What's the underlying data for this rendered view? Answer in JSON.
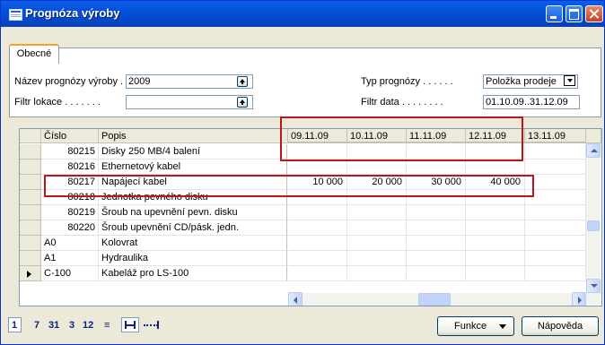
{
  "window": {
    "title": "Prognóza výroby"
  },
  "tabs": [
    {
      "label": "Obecné"
    }
  ],
  "form": {
    "forecast_name_label": "Název prognózy výroby .",
    "forecast_name_value": "2009",
    "location_filter_label": "Filtr lokace . . . . . . .",
    "location_filter_value": "",
    "forecast_type_label": "Typ prognózy . . . . . .",
    "forecast_type_value": "Položka prodeje",
    "date_filter_label": "Filtr data . . . . . . . .",
    "date_filter_value": "01.10.09..31.12.09"
  },
  "grid": {
    "headers": {
      "no": "Číslo",
      "desc": "Popis"
    },
    "date_headers": [
      "09.11.09",
      "10.11.09",
      "11.11.09",
      "12.11.09",
      "13.11.09"
    ],
    "rows": [
      {
        "no": "80215",
        "desc": "Disky 250 MB/4 balení",
        "vals": [
          "",
          "",
          "",
          "",
          ""
        ]
      },
      {
        "no": "80216",
        "desc": "Ethernetový kabel",
        "vals": [
          "",
          "",
          "",
          "",
          ""
        ]
      },
      {
        "no": "80217",
        "desc": "Napájecí kabel",
        "vals": [
          "10 000",
          "20 000",
          "30 000",
          "40 000",
          ""
        ]
      },
      {
        "no": "80218",
        "desc": "Jednotka pevného disku",
        "vals": [
          "",
          "",
          "",
          "",
          ""
        ]
      },
      {
        "no": "80219",
        "desc": "Šroub na upevnění pevn. disku",
        "vals": [
          "",
          "",
          "",
          "",
          ""
        ]
      },
      {
        "no": "80220",
        "desc": "Šroub upevnění CD/pásk. jedn.",
        "vals": [
          "",
          "",
          "",
          "",
          ""
        ]
      },
      {
        "no": "A0",
        "desc": "Kolovrat",
        "vals": [
          "",
          "",
          "",
          "",
          ""
        ]
      },
      {
        "no": "A1",
        "desc": "Hydraulika",
        "vals": [
          "",
          "",
          "",
          "",
          ""
        ]
      },
      {
        "no": "C-100",
        "desc": "Kabeláž pro LS-100",
        "vals": [
          "",
          "",
          "",
          "",
          ""
        ]
      }
    ],
    "current_row": 8
  },
  "footer": {
    "periods": [
      "1",
      "7",
      "31",
      "3",
      "12",
      "≡"
    ],
    "functions_label": "Funkce",
    "help_label": "Nápověda"
  }
}
